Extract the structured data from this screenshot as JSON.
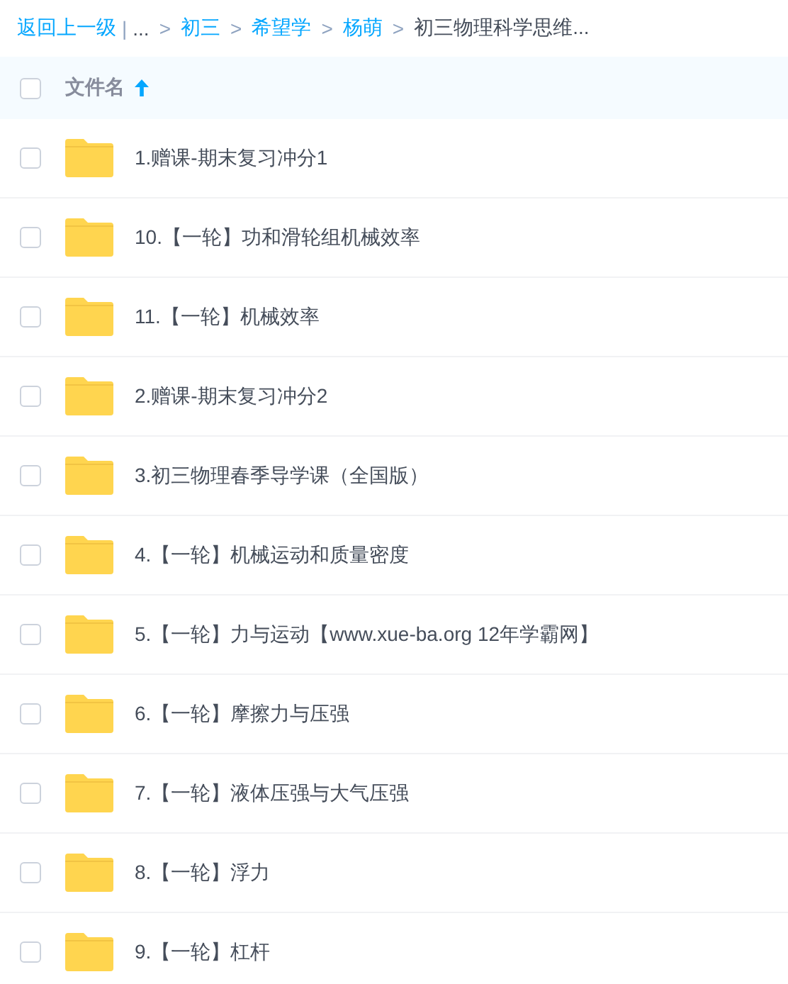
{
  "breadcrumb": {
    "back": "返回上一级",
    "divider": "|",
    "items": [
      {
        "label": "...",
        "link": false
      },
      {
        "separator": ">",
        "label": "初三",
        "link": true
      },
      {
        "separator": ">",
        "label": "希望学",
        "link": true
      },
      {
        "separator": ">",
        "label": "杨萌",
        "link": true
      },
      {
        "separator": ">",
        "label": "初三物理科学思维...",
        "link": false
      }
    ]
  },
  "table": {
    "header": {
      "checked": false,
      "label": "文件名",
      "sort_ascending": true
    },
    "rows": [
      {
        "checked": false,
        "kind": "folder",
        "name": "1.赠课-期末复习冲分1"
      },
      {
        "checked": false,
        "kind": "folder",
        "name": "10.【一轮】功和滑轮组机械效率"
      },
      {
        "checked": false,
        "kind": "folder",
        "name": "11.【一轮】机械效率"
      },
      {
        "checked": false,
        "kind": "folder",
        "name": "2.赠课-期末复习冲分2"
      },
      {
        "checked": false,
        "kind": "folder",
        "name": "3.初三物理春季导学课（全国版）"
      },
      {
        "checked": false,
        "kind": "folder",
        "name": "4.【一轮】机械运动和质量密度"
      },
      {
        "checked": false,
        "kind": "folder",
        "name": "5.【一轮】力与运动【www.xue-ba.org 12年学霸网】"
      },
      {
        "checked": false,
        "kind": "folder",
        "name": "6.【一轮】摩擦力与压强"
      },
      {
        "checked": false,
        "kind": "folder",
        "name": "7.【一轮】液体压强与大气压强"
      },
      {
        "checked": false,
        "kind": "folder",
        "name": "8.【一轮】浮力"
      },
      {
        "checked": false,
        "kind": "folder",
        "name": "9.【一轮】杠杆"
      }
    ]
  }
}
